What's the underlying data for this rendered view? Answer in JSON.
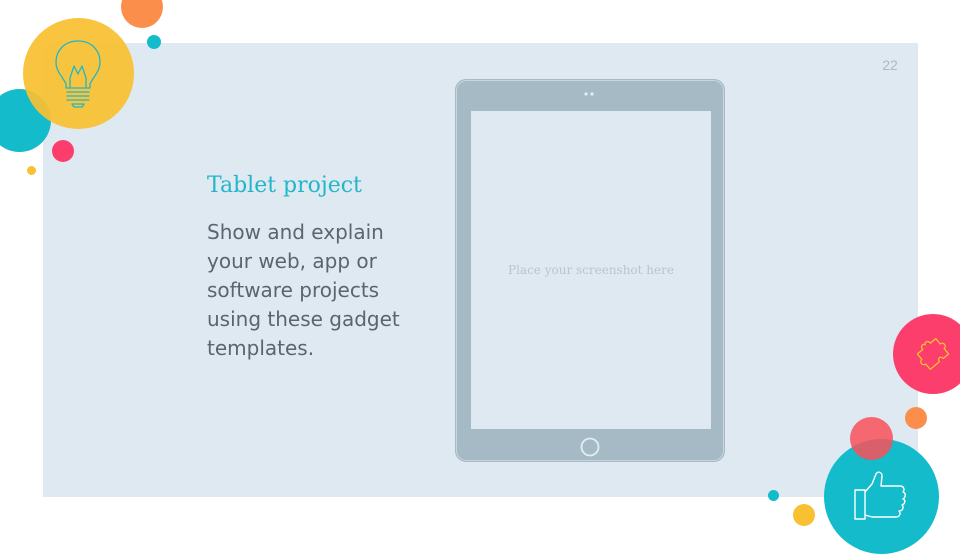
{
  "slide": {
    "page_number": "22",
    "title": "Tablet project",
    "body": "Show and explain your web, app or software projects using these gadget templates.",
    "tablet": {
      "placeholder": "Place your screenshot  here"
    }
  },
  "decor": {
    "icons": [
      "lightbulb-icon",
      "puzzle-icon",
      "thumbs-up-icon"
    ]
  },
  "colors": {
    "panel": "#dfe9f2",
    "accent_teal": "#22b6c8",
    "yellow": "#f9c132",
    "pink": "#fb3e6c",
    "orange": "#fb8e4a",
    "tablet_gray": "#a6bac6"
  }
}
